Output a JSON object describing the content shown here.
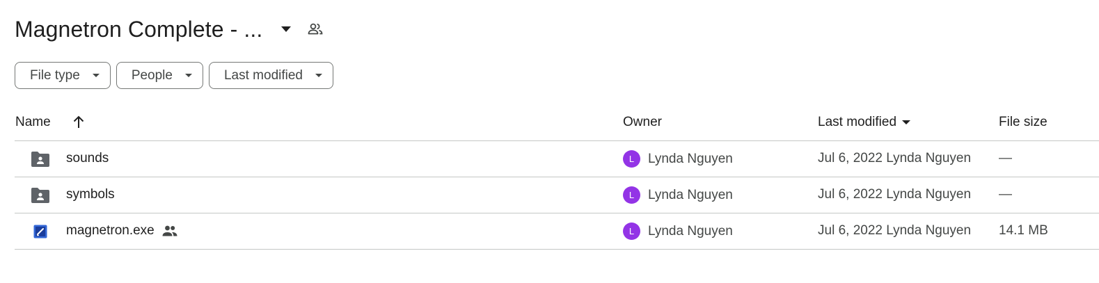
{
  "header": {
    "title": "Magnetron Complete - ...",
    "caret_icon": "arrow-drop-down-icon",
    "shared_icon": "people-icon"
  },
  "filters": [
    {
      "label": "File type"
    },
    {
      "label": "People"
    },
    {
      "label": "Last modified"
    }
  ],
  "table": {
    "columns": {
      "name": "Name",
      "owner": "Owner",
      "last_modified": "Last modified",
      "file_size": "File size"
    },
    "rows": [
      {
        "name": "sounds",
        "type": "shared-folder",
        "owner_initial": "L",
        "owner": "Lynda Nguyen",
        "modified": "Jul 6, 2022 Lynda Nguyen",
        "size": "—"
      },
      {
        "name": "symbols",
        "type": "shared-folder",
        "owner_initial": "L",
        "owner": "Lynda Nguyen",
        "modified": "Jul 6, 2022 Lynda Nguyen",
        "size": "—"
      },
      {
        "name": "magnetron.exe",
        "type": "executable",
        "owner_initial": "L",
        "owner": "Lynda Nguyen",
        "modified": "Jul 6, 2022 Lynda Nguyen",
        "size": "14.1 MB"
      }
    ]
  },
  "colors": {
    "avatar": "#9334e6",
    "folder_icon": "#5f6368",
    "exe_icon": "#3367d6",
    "divider": "#c4c7c5"
  }
}
